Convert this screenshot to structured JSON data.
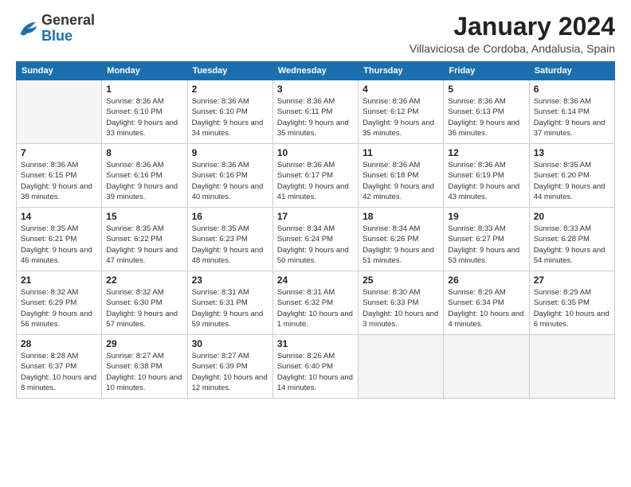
{
  "header": {
    "logo_general": "General",
    "logo_blue": "Blue",
    "month_title": "January 2024",
    "location": "Villaviciosa de Cordoba, Andalusia, Spain"
  },
  "weekdays": [
    "Sunday",
    "Monday",
    "Tuesday",
    "Wednesday",
    "Thursday",
    "Friday",
    "Saturday"
  ],
  "weeks": [
    [
      {
        "day": "",
        "empty": true
      },
      {
        "day": "1",
        "sunrise": "Sunrise: 8:36 AM",
        "sunset": "Sunset: 6:10 PM",
        "daylight": "Daylight: 9 hours and 33 minutes."
      },
      {
        "day": "2",
        "sunrise": "Sunrise: 8:36 AM",
        "sunset": "Sunset: 6:10 PM",
        "daylight": "Daylight: 9 hours and 34 minutes."
      },
      {
        "day": "3",
        "sunrise": "Sunrise: 8:36 AM",
        "sunset": "Sunset: 6:11 PM",
        "daylight": "Daylight: 9 hours and 35 minutes."
      },
      {
        "day": "4",
        "sunrise": "Sunrise: 8:36 AM",
        "sunset": "Sunset: 6:12 PM",
        "daylight": "Daylight: 9 hours and 35 minutes."
      },
      {
        "day": "5",
        "sunrise": "Sunrise: 8:36 AM",
        "sunset": "Sunset: 6:13 PM",
        "daylight": "Daylight: 9 hours and 36 minutes."
      },
      {
        "day": "6",
        "sunrise": "Sunrise: 8:36 AM",
        "sunset": "Sunset: 6:14 PM",
        "daylight": "Daylight: 9 hours and 37 minutes."
      }
    ],
    [
      {
        "day": "7",
        "sunrise": "Sunrise: 8:36 AM",
        "sunset": "Sunset: 6:15 PM",
        "daylight": "Daylight: 9 hours and 38 minutes."
      },
      {
        "day": "8",
        "sunrise": "Sunrise: 8:36 AM",
        "sunset": "Sunset: 6:16 PM",
        "daylight": "Daylight: 9 hours and 39 minutes."
      },
      {
        "day": "9",
        "sunrise": "Sunrise: 8:36 AM",
        "sunset": "Sunset: 6:16 PM",
        "daylight": "Daylight: 9 hours and 40 minutes."
      },
      {
        "day": "10",
        "sunrise": "Sunrise: 8:36 AM",
        "sunset": "Sunset: 6:17 PM",
        "daylight": "Daylight: 9 hours and 41 minutes."
      },
      {
        "day": "11",
        "sunrise": "Sunrise: 8:36 AM",
        "sunset": "Sunset: 6:18 PM",
        "daylight": "Daylight: 9 hours and 42 minutes."
      },
      {
        "day": "12",
        "sunrise": "Sunrise: 8:36 AM",
        "sunset": "Sunset: 6:19 PM",
        "daylight": "Daylight: 9 hours and 43 minutes."
      },
      {
        "day": "13",
        "sunrise": "Sunrise: 8:35 AM",
        "sunset": "Sunset: 6:20 PM",
        "daylight": "Daylight: 9 hours and 44 minutes."
      }
    ],
    [
      {
        "day": "14",
        "sunrise": "Sunrise: 8:35 AM",
        "sunset": "Sunset: 6:21 PM",
        "daylight": "Daylight: 9 hours and 46 minutes."
      },
      {
        "day": "15",
        "sunrise": "Sunrise: 8:35 AM",
        "sunset": "Sunset: 6:22 PM",
        "daylight": "Daylight: 9 hours and 47 minutes."
      },
      {
        "day": "16",
        "sunrise": "Sunrise: 8:35 AM",
        "sunset": "Sunset: 6:23 PM",
        "daylight": "Daylight: 9 hours and 48 minutes."
      },
      {
        "day": "17",
        "sunrise": "Sunrise: 8:34 AM",
        "sunset": "Sunset: 6:24 PM",
        "daylight": "Daylight: 9 hours and 50 minutes."
      },
      {
        "day": "18",
        "sunrise": "Sunrise: 8:34 AM",
        "sunset": "Sunset: 6:26 PM",
        "daylight": "Daylight: 9 hours and 51 minutes."
      },
      {
        "day": "19",
        "sunrise": "Sunrise: 8:33 AM",
        "sunset": "Sunset: 6:27 PM",
        "daylight": "Daylight: 9 hours and 53 minutes."
      },
      {
        "day": "20",
        "sunrise": "Sunrise: 8:33 AM",
        "sunset": "Sunset: 6:28 PM",
        "daylight": "Daylight: 9 hours and 54 minutes."
      }
    ],
    [
      {
        "day": "21",
        "sunrise": "Sunrise: 8:32 AM",
        "sunset": "Sunset: 6:29 PM",
        "daylight": "Daylight: 9 hours and 56 minutes."
      },
      {
        "day": "22",
        "sunrise": "Sunrise: 8:32 AM",
        "sunset": "Sunset: 6:30 PM",
        "daylight": "Daylight: 9 hours and 57 minutes."
      },
      {
        "day": "23",
        "sunrise": "Sunrise: 8:31 AM",
        "sunset": "Sunset: 6:31 PM",
        "daylight": "Daylight: 9 hours and 59 minutes."
      },
      {
        "day": "24",
        "sunrise": "Sunrise: 8:31 AM",
        "sunset": "Sunset: 6:32 PM",
        "daylight": "Daylight: 10 hours and 1 minute."
      },
      {
        "day": "25",
        "sunrise": "Sunrise: 8:30 AM",
        "sunset": "Sunset: 6:33 PM",
        "daylight": "Daylight: 10 hours and 3 minutes."
      },
      {
        "day": "26",
        "sunrise": "Sunrise: 8:29 AM",
        "sunset": "Sunset: 6:34 PM",
        "daylight": "Daylight: 10 hours and 4 minutes."
      },
      {
        "day": "27",
        "sunrise": "Sunrise: 8:29 AM",
        "sunset": "Sunset: 6:35 PM",
        "daylight": "Daylight: 10 hours and 6 minutes."
      }
    ],
    [
      {
        "day": "28",
        "sunrise": "Sunrise: 8:28 AM",
        "sunset": "Sunset: 6:37 PM",
        "daylight": "Daylight: 10 hours and 8 minutes."
      },
      {
        "day": "29",
        "sunrise": "Sunrise: 8:27 AM",
        "sunset": "Sunset: 6:38 PM",
        "daylight": "Daylight: 10 hours and 10 minutes."
      },
      {
        "day": "30",
        "sunrise": "Sunrise: 8:27 AM",
        "sunset": "Sunset: 6:39 PM",
        "daylight": "Daylight: 10 hours and 12 minutes."
      },
      {
        "day": "31",
        "sunrise": "Sunrise: 8:26 AM",
        "sunset": "Sunset: 6:40 PM",
        "daylight": "Daylight: 10 hours and 14 minutes."
      },
      {
        "day": "",
        "empty": true
      },
      {
        "day": "",
        "empty": true
      },
      {
        "day": "",
        "empty": true
      }
    ]
  ]
}
